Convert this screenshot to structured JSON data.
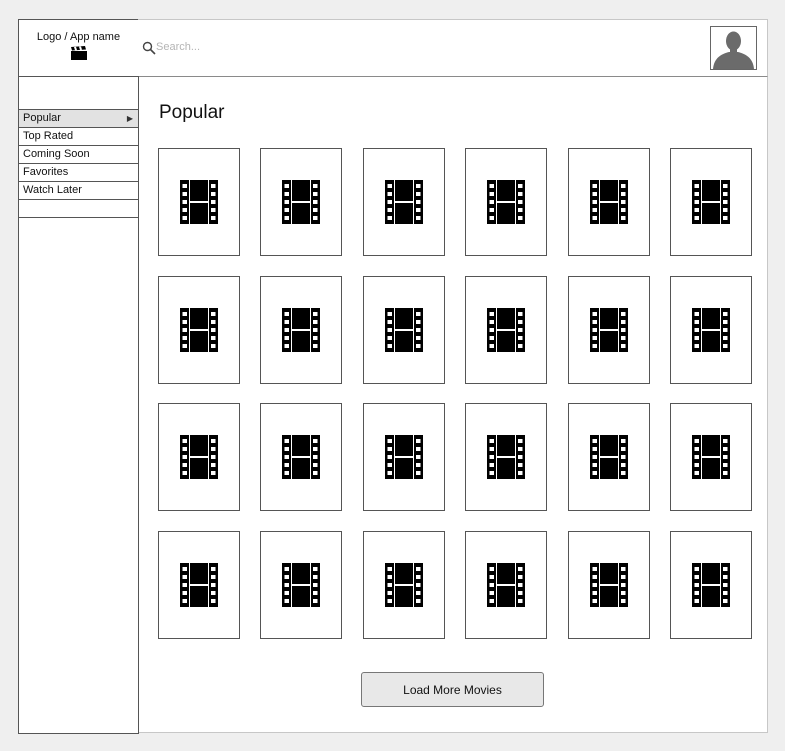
{
  "header": {
    "logo_text": "Logo / App name",
    "logo_icon": "clapperboard-icon",
    "search": {
      "placeholder": "Search...",
      "value": "",
      "icon": "search-icon"
    },
    "avatar_icon": "user-avatar-icon"
  },
  "sidebar": {
    "items": [
      {
        "label": "Popular",
        "active": true,
        "indicator_icon": "triangle-right-icon"
      },
      {
        "label": "Top Rated",
        "active": false
      },
      {
        "label": "Coming Soon",
        "active": false
      },
      {
        "label": "Favorites",
        "active": false
      },
      {
        "label": "Watch Later",
        "active": false
      },
      {
        "label": "",
        "active": false
      }
    ]
  },
  "main": {
    "title": "Popular",
    "grid": {
      "rows": 4,
      "columns": 6,
      "card_icon": "film-strip-icon"
    },
    "load_more_label": "Load More Movies"
  },
  "colors": {
    "background": "#efefef",
    "border": "#555555",
    "active_nav": "#e2e2e2",
    "button": "#e8e8e8"
  }
}
